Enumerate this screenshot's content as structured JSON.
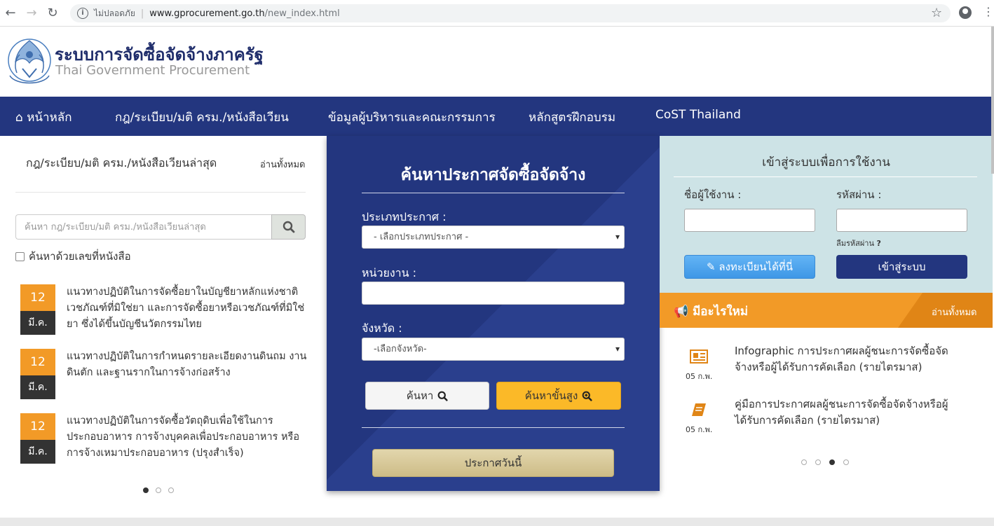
{
  "browser": {
    "security_label": "ไม่ปลอดภัย",
    "url_host": "www.gprocurement.go.th",
    "url_path": "/new_index.html"
  },
  "header": {
    "title_th": "ระบบการจัดซื้อจัดจ้างภาครัฐ",
    "title_en": "Thai Government Procurement"
  },
  "nav": {
    "home": "หน้าหลัก",
    "regulations": "กฎ/ระเบียบ/มติ ครม./หนังสือเวียน",
    "executives": "ข้อมูลผู้บริหารและคณะกรรมการ",
    "training": "หลักสูตรฝึกอบรม",
    "cost": "CoST Thailand"
  },
  "regulations": {
    "title": "กฎ/ระเบียบ/มติ ครม./หนังสือเวียนล่าสุด",
    "read_all": "อ่านทั้งหมด",
    "search_placeholder": "ค้นหา กฎ/ระเบียบ/มติ ครม./หนังสือเวียนล่าสุด",
    "checkbox_label": "ค้นหาด้วยเลขที่หนังสือ",
    "items": [
      {
        "day": "12",
        "month": "มี.ค.",
        "text": "แนวทางปฏิบัติในการจัดซื้อยาในบัญชียาหลักแห่งชาติ เวชภัณฑ์ที่มิใช่ยา และการจัดซื้อยาหรือเวชภัณฑ์ที่มิใช่ยา ซึ่งได้ขึ้นบัญชีนวัตกรรมไทย"
      },
      {
        "day": "12",
        "month": "มี.ค.",
        "text": "แนวทางปฏิบัติในการกำหนดรายละเอียดงานดินถม งานดินตัก และฐานรากในการจ้างก่อสร้าง"
      },
      {
        "day": "12",
        "month": "มี.ค.",
        "text": "แนวทางปฏิบัติในการจัดซื้อวัตถุดิบเพื่อใช้ในการประกอบอาหาร การจ้างบุคคลเพื่อประกอบอาหาร หรือการจ้างเหมาประกอบอาหาร (ปรุงสำเร็จ)"
      }
    ]
  },
  "search_panel": {
    "title": "ค้นหาประกาศจัดซื้อจัดจ้าง",
    "announce_type_label": "ประเภทประกาศ :",
    "announce_type_value": "- เลือกประเภทประกาศ -",
    "agency_label": "หน่วยงาน :",
    "province_label": "จังหวัด :",
    "province_value": "-เลือกจังหวัด-",
    "search_button": "ค้นหา",
    "advanced_button": "ค้นหาขั้นสูง",
    "today_button": "ประกาศวันนี้"
  },
  "login": {
    "title": "เข้าสู่ระบบเพื่อการใช้งาน",
    "username_label": "ชื่อผู้ใช้งาน :",
    "password_label": "รหัสผ่าน :",
    "forgot_label": "ลืมรหัสผ่าน",
    "forgot_mark": "?",
    "register_button": "ลงทะเบียนได้ที่นี่",
    "login_button": "เข้าสู่ระบบ"
  },
  "whats_new": {
    "title": "มีอะไรใหม่",
    "read_all": "อ่านทั้งหมด",
    "items": [
      {
        "date": "05 ก.พ.",
        "icon": "newspaper-icon",
        "text": "Infographic การประกาศผลผู้ชนะการจัดซื้อจัดจ้างหรือผู้ได้รับการคัดเลือก (รายไตรมาส)"
      },
      {
        "date": "05 ก.พ.",
        "icon": "book-icon",
        "text": "คู่มือการประกาศผลผู้ชนะการจัดซื้อจัดจ้างหรือผู้ได้รับการคัดเลือก (รายไตรมาส)"
      }
    ]
  },
  "colors": {
    "navy": "#23367f",
    "orange": "#f29a27",
    "light_teal": "#cde3e6",
    "gold": "#fbb928"
  }
}
